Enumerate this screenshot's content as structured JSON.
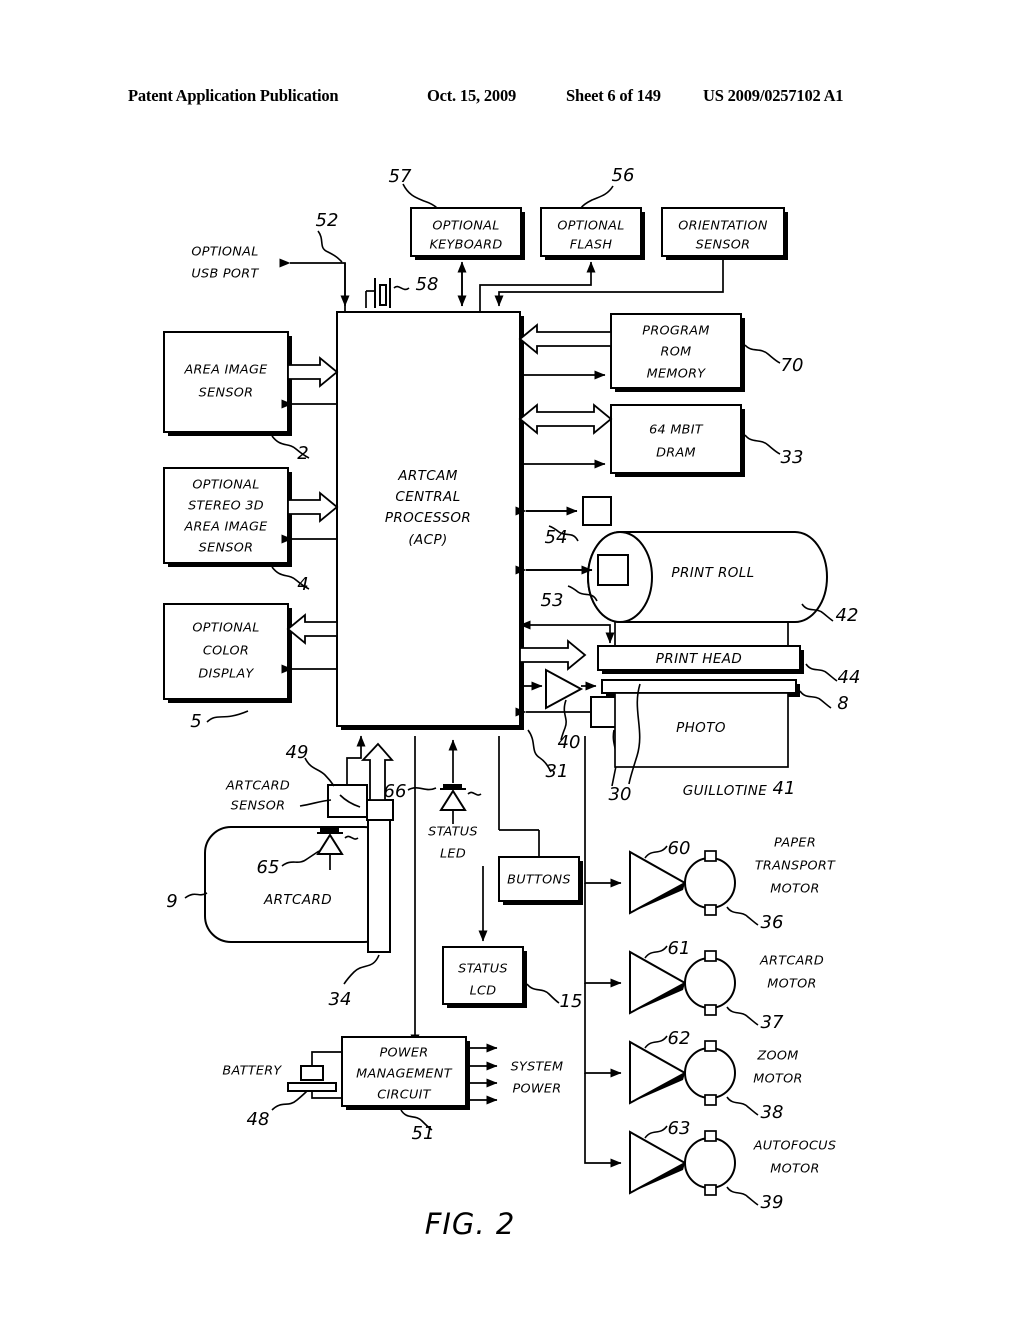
{
  "header": {
    "publication": "Patent Application Publication",
    "date": "Oct. 15, 2009",
    "sheet": "Sheet 6 of 149",
    "number": "US 2009/0257102 A1"
  },
  "figure": {
    "caption": "FIG. 2"
  },
  "diagram": {
    "title": "ARTCAM camera system block diagram",
    "blocks": {
      "usb_port": "OPTIONAL\nUSB PORT",
      "optional_keyboard": "OPTIONAL\nKEYBOARD",
      "optional_flash": "OPTIONAL\nFLASH",
      "orientation_sensor": "ORIENTATION\nSENSOR",
      "area_image_sensor": "AREA IMAGE\nSENSOR",
      "stereo_sensor": "OPTIONAL\nSTEREO 3D\nAREA IMAGE\nSENSOR",
      "color_display": "OPTIONAL\nCOLOR\nDISPLAY",
      "acp": "ARTCAM\nCENTRAL\nPROCESSOR\n(ACP)",
      "program_rom": "PROGRAM\nROM\nMEMORY",
      "dram": "64 MBIT\nDRAM",
      "print_roll": "PRINT ROLL",
      "print_head": "PRINT HEAD",
      "photo": "PHOTO",
      "guillotine": "GUILLOTINE",
      "artcard_sensor": "ARTCARD\nSENSOR",
      "artcard": "ARTCARD",
      "status_led": "STATUS\nLED",
      "status_lcd": "STATUS\nLCD",
      "buttons": "BUTTONS",
      "battery": "BATTERY",
      "power_management": "POWER\nMANAGEMENT\nCIRCUIT",
      "system_power": "SYSTEM\nPOWER",
      "paper_transport_motor": "PAPER\nTRANSPORT\nMOTOR",
      "artcard_motor": "ARTCARD\nMOTOR",
      "zoom_motor": "ZOOM\nMOTOR",
      "autofocus_motor": "AUTOFOCUS\nMOTOR"
    },
    "block_lines": {
      "usb_port": [
        "OPTIONAL",
        "USB PORT"
      ],
      "optional_keyboard": [
        "OPTIONAL",
        "KEYBOARD"
      ],
      "optional_flash": [
        "OPTIONAL",
        "FLASH"
      ],
      "orientation_sensor": [
        "ORIENTATION",
        "SENSOR"
      ],
      "area_image_sensor": [
        "AREA IMAGE",
        "SENSOR"
      ],
      "stereo_sensor": [
        "OPTIONAL",
        "STEREO 3D",
        "AREA IMAGE",
        "SENSOR"
      ],
      "color_display": [
        "OPTIONAL",
        "COLOR",
        "DISPLAY"
      ],
      "acp": [
        "ARTCAM",
        "CENTRAL",
        "PROCESSOR",
        "(ACP)"
      ],
      "program_rom": [
        "PROGRAM",
        "ROM",
        "MEMORY"
      ],
      "dram": [
        "64 MBIT",
        "DRAM"
      ],
      "artcard_sensor": [
        "ARTCARD",
        "SENSOR"
      ],
      "status_led": [
        "STATUS",
        "LED"
      ],
      "status_lcd": [
        "STATUS",
        "LCD"
      ],
      "power_management": [
        "POWER",
        "MANAGEMENT",
        "CIRCUIT"
      ],
      "system_power": [
        "SYSTEM",
        "POWER"
      ],
      "paper_transport_motor": [
        "PAPER",
        "TRANSPORT",
        "MOTOR"
      ],
      "artcard_motor": [
        "ARTCARD",
        "MOTOR"
      ],
      "zoom_motor": [
        "ZOOM",
        "MOTOR"
      ],
      "autofocus_motor": [
        "AUTOFOCUS",
        "MOTOR"
      ]
    },
    "reference_numerals": {
      "n2": "2",
      "n4": "4",
      "n5": "5",
      "n8": "8",
      "n9": "9",
      "n15": "15",
      "n30": "30",
      "n31": "31",
      "n33": "33",
      "n34": "34",
      "n36": "36",
      "n37": "37",
      "n38": "38",
      "n39": "39",
      "n40": "40",
      "n41": "41",
      "n42": "42",
      "n44": "44",
      "n48": "48",
      "n49": "49",
      "n51": "51",
      "n52": "52",
      "n53": "53",
      "n54": "54",
      "n56": "56",
      "n57": "57",
      "n58": "58",
      "n60": "60",
      "n61": "61",
      "n62": "62",
      "n63": "63",
      "n65": "65",
      "n66": "66",
      "n70": "70"
    }
  }
}
